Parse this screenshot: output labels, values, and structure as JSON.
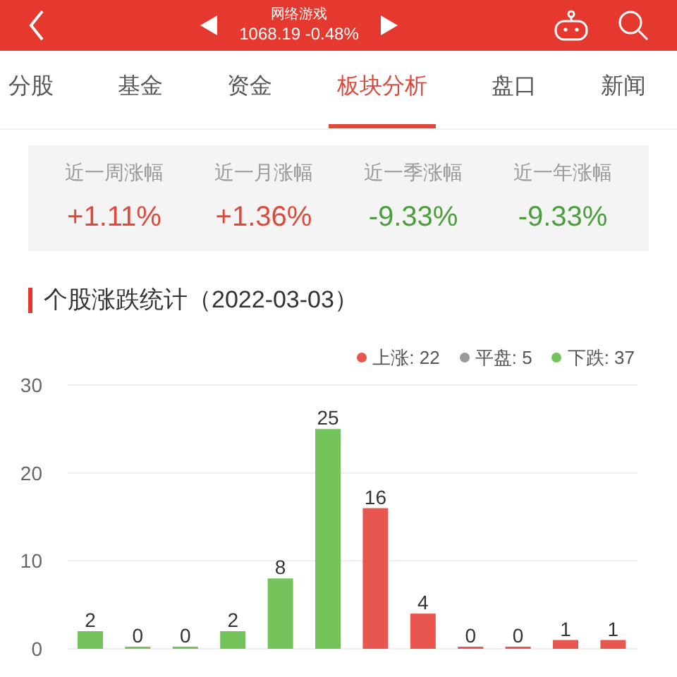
{
  "header": {
    "title": "网络游戏",
    "quote": "1068.19 -0.48%"
  },
  "tabs": [
    {
      "label": "分股",
      "selected": false
    },
    {
      "label": "基金",
      "selected": false
    },
    {
      "label": "资金",
      "selected": false
    },
    {
      "label": "板块分析",
      "selected": true
    },
    {
      "label": "盘口",
      "selected": false
    },
    {
      "label": "新闻",
      "selected": false
    }
  ],
  "summary": [
    {
      "label": "近一周涨幅",
      "value": "+1.11%",
      "color": "#e0483c"
    },
    {
      "label": "近一月涨幅",
      "value": "+1.36%",
      "color": "#e0483c"
    },
    {
      "label": "近一季涨幅",
      "value": "-9.33%",
      "color": "#4a9e3c"
    },
    {
      "label": "近一年涨幅",
      "value": "-9.33%",
      "color": "#4a9e3c"
    }
  ],
  "section_title": "个股涨跌统计（2022-03-03）",
  "legend": [
    {
      "label": "上涨: 22",
      "color": "#e8574f"
    },
    {
      "label": "平盘: 5",
      "color": "#999999"
    },
    {
      "label": "下跌: 37",
      "color": "#73c25a"
    }
  ],
  "chart": {
    "chart_data": {
      "type": "bar",
      "data_labels": true,
      "ylim": [
        0,
        30
      ],
      "yticks": [
        0,
        10,
        20,
        30
      ],
      "series": [
        {
          "color": "#73c25a",
          "values": [
            2,
            0,
            0,
            2,
            8,
            25,
            null,
            null,
            null,
            null,
            null,
            null
          ]
        },
        {
          "color": "#e8574f",
          "values": [
            null,
            null,
            null,
            null,
            null,
            null,
            16,
            4,
            0,
            0,
            1,
            1
          ]
        }
      ]
    }
  }
}
